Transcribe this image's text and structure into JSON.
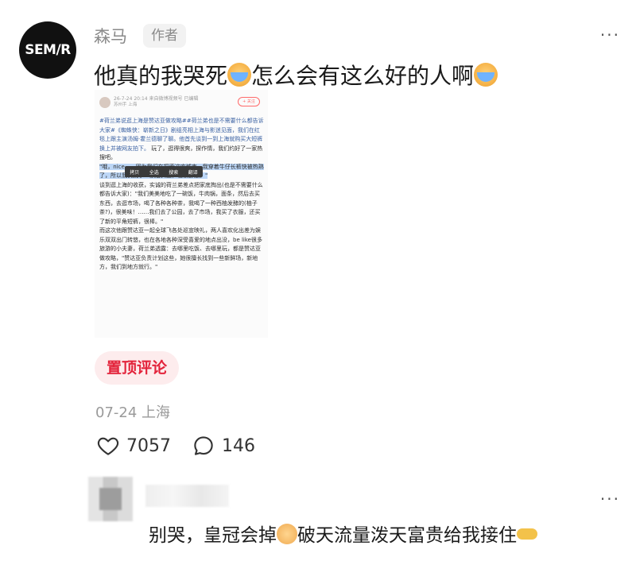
{
  "header": {
    "avatar_text": "SEM/R",
    "username": "森马",
    "author_badge": "作者",
    "more_label": "···"
  },
  "comment": {
    "text_part1": "他真的我哭死",
    "text_part2": "怎么会有这么好的人啊",
    "emoji": "crying-face-icon"
  },
  "embedded_screenshot": {
    "header_line": "26-7-24 20:14 来自微博视频号 已编辑",
    "header_meta": "苏州手 上海",
    "follow_label": "+ 关注",
    "paragraph_1": "#荷兰弟说逛上海是赞达亚做攻略##荷兰弟也是不需要什么都告诉大家#《蜘蛛侠：崭新之日》剧组亮相上海与影迷见面，我们在红毯上跟主演汤姆·霍兰德聊了聊。他首先谈到一到上海就购买大短裤换上并被网友拍下。",
    "menu_items": [
      "拷贝",
      "全选",
      "搜索",
      "翻译"
    ],
    "paragraph_2": "玩了，逛得很爽，探作情，我们约好了一家热搜吧。",
    "highlighted": "\"哦，nice——因为我们在探索这座城市，我穿着牛仔长裤快被热熟了，所以我们找了一家店买上，也很舒服。\"",
    "paragraph_3": "谈到逛上海的收获，实诚的荷兰弟差点把家底掏出(也是不需要什么都告诉大家)：\"我们美美地吃了一碗饭，牛肉锅，面条，然后去买东西，去逛市场，喝了各种各种茶，我喝了一种西柚发酵的(柚子茶?)，很美味！……我们去了公园，去了市场，我买了衣服，还买了新的平角短裤，很棒。\"",
    "paragraph_4": "而这次他跟赞达亚一起全球飞各处巡宣映礼，两人喜欢化出差为娱乐双双出门转悠，也在各地各种深受喜爱的地点出没，be like很多旅游的小夫妻，荷兰弟透露：去哪里吃饭、去哪里玩，都是赞达亚做攻略，\"赞达亚负责计划这些，她很擅长找到一些新鲜场，新地方，我们到地方就行。\""
  },
  "pinned_label": "置顶评论",
  "meta": {
    "date": "07-24",
    "location": "上海"
  },
  "stats": {
    "likes": "7057",
    "comments": "146"
  },
  "reply": {
    "more_label": "···",
    "text_part1": "别哭，皇冠会掉",
    "text_part2": "破天流量泼天富贵给我接住",
    "emoji_1": "dog-face-icon",
    "emoji_2": "catching-hand-icon"
  }
}
